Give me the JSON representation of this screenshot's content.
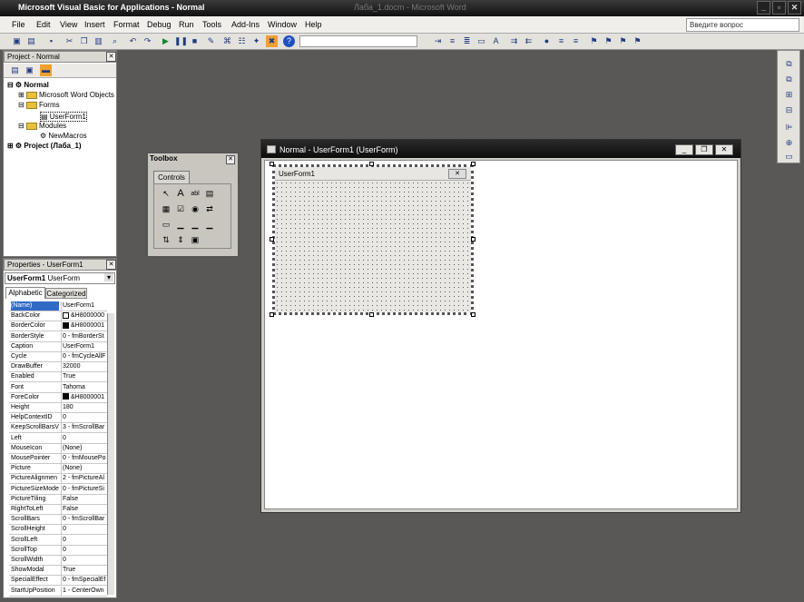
{
  "window": {
    "title": "Microsoft Visual Basic for Applications - Normal",
    "background_text": "Лаба_1.docm - Microsoft Word"
  },
  "menu": [
    "File",
    "Edit",
    "View",
    "Insert",
    "Format",
    "Debug",
    "Run",
    "Tools",
    "Add-Ins",
    "Window",
    "Help"
  ],
  "help_box": {
    "placeholder": "Введите вопрос"
  },
  "project": {
    "title": "Project - Normal",
    "tree": [
      {
        "label": "Normal",
        "level": 0
      },
      {
        "label": "Microsoft Word Objects",
        "level": 1
      },
      {
        "label": "Forms",
        "level": 1
      },
      {
        "label": "UserForm1",
        "level": 2
      },
      {
        "label": "Modules",
        "level": 1
      },
      {
        "label": "NewMacros",
        "level": 2
      },
      {
        "label": "Project (Лаба_1)",
        "level": 0
      }
    ]
  },
  "properties": {
    "title": "Properties - UserForm1",
    "object": "UserForm1",
    "object_type": "UserForm",
    "tabs": [
      "Alphabetic",
      "Categorized"
    ],
    "rows": [
      [
        "(Name)",
        "UserForm1"
      ],
      [
        "BackColor",
        "&H8000000"
      ],
      [
        "BorderColor",
        "&H8000001"
      ],
      [
        "BorderStyle",
        "0 - fmBorderSt"
      ],
      [
        "Caption",
        "UserForm1"
      ],
      [
        "Cycle",
        "0 - fmCycleAllF"
      ],
      [
        "DrawBuffer",
        "32000"
      ],
      [
        "Enabled",
        "True"
      ],
      [
        "Font",
        "Tahoma"
      ],
      [
        "ForeColor",
        "&H8000001"
      ],
      [
        "Height",
        "180"
      ],
      [
        "HelpContextID",
        "0"
      ],
      [
        "KeepScrollBarsV",
        "3 - fmScrollBar"
      ],
      [
        "Left",
        "0"
      ],
      [
        "MouseIcon",
        "(None)"
      ],
      [
        "MousePointer",
        "0 - fmMousePo"
      ],
      [
        "Picture",
        "(None)"
      ],
      [
        "PictureAlignmen",
        "2 - fmPictureAl"
      ],
      [
        "PictureSizeMode",
        "0 - fmPictureSi"
      ],
      [
        "PictureTiling",
        "False"
      ],
      [
        "RightToLeft",
        "False"
      ],
      [
        "ScrollBars",
        "0 - fmScrollBar"
      ],
      [
        "ScrollHeight",
        "0"
      ],
      [
        "ScrollLeft",
        "0"
      ],
      [
        "ScrollTop",
        "0"
      ],
      [
        "ScrollWidth",
        "0"
      ],
      [
        "ShowModal",
        "True"
      ],
      [
        "SpecialEffect",
        "0 - fmSpecialEf"
      ],
      [
        "StartUpPosition",
        "1 - CenterOwn"
      ]
    ]
  },
  "toolbox": {
    "title": "Toolbox",
    "tab": "Controls",
    "tools": [
      "↖",
      "A",
      "abl",
      "▤",
      "▦",
      "☑",
      "◉",
      "⇄",
      "▭",
      "▁",
      "▁",
      "▁",
      "⇅",
      "⇕",
      "▣"
    ]
  },
  "document": {
    "caption": "Normal - UserForm1 (UserForm)",
    "form_caption": "UserForm1"
  }
}
